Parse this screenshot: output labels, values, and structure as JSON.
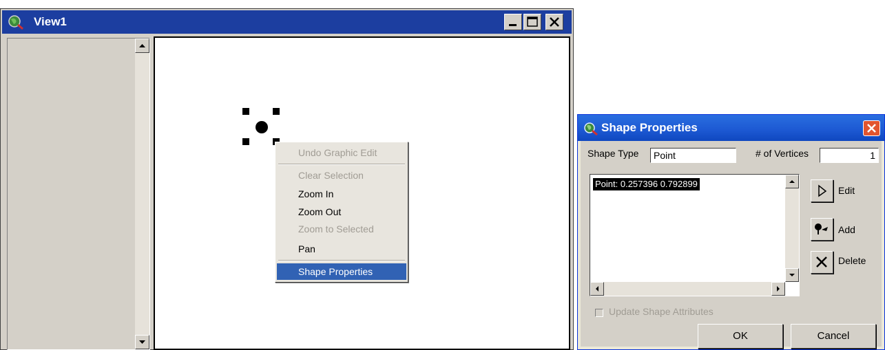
{
  "view_window": {
    "title": "View1",
    "title_bar_color": "#1c3ea0",
    "icons": [
      "app-globe-icon",
      "minimize-icon",
      "maximize-icon",
      "close-icon",
      "scroll-up-arrow-icon",
      "scroll-down-arrow-icon"
    ]
  },
  "context_menu": {
    "items": [
      {
        "label": "Undo Graphic Edit",
        "state": "disabled"
      },
      {
        "label": "Clear Selection",
        "state": "disabled"
      },
      {
        "label": "Zoom In",
        "state": "enabled"
      },
      {
        "label": "Zoom Out",
        "state": "enabled"
      },
      {
        "label": "Zoom to Selected",
        "state": "disabled"
      },
      {
        "label": "Pan",
        "state": "enabled"
      },
      {
        "label": "Shape Properties",
        "state": "highlighted"
      }
    ],
    "highlight_color": "#3162b4"
  },
  "dialog": {
    "title": "Shape Properties",
    "title_bar_color": "#1c58d2",
    "shape_type_label": "Shape Type",
    "shape_type_value": "Point",
    "vertices_label": "# of Vertices",
    "vertices_value": "1",
    "list_items": [
      "Point: 0.257396 0.792899"
    ],
    "edit_label": "Edit",
    "add_label": "Add",
    "delete_label": "Delete",
    "update_attributes_label": "Update Shape Attributes",
    "update_attributes_checked": false,
    "ok_label": "OK",
    "cancel_label": "Cancel",
    "icons": [
      "dialog-globe-icon",
      "dialog-close-icon",
      "edit-pointer-icon",
      "add-vertex-icon",
      "delete-x-icon"
    ]
  }
}
